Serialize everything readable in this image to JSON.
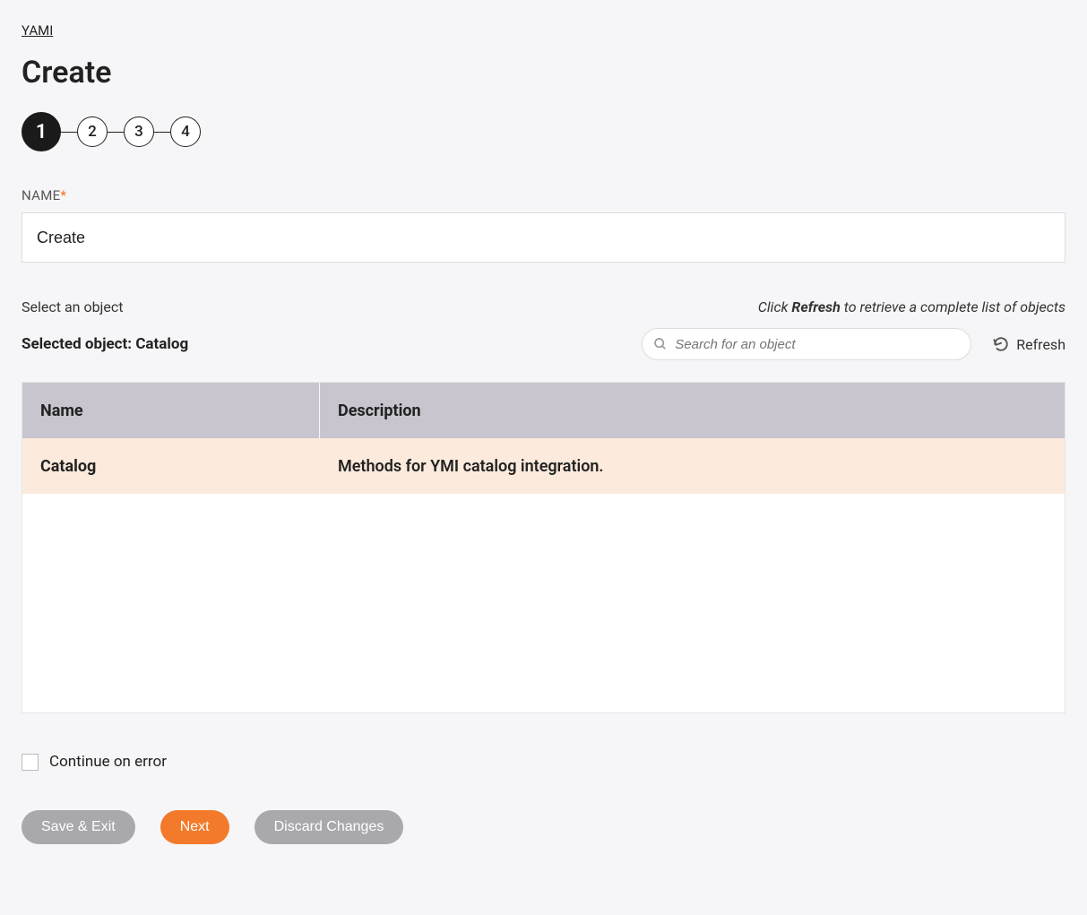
{
  "breadcrumb": "YAMI",
  "page_title": "Create",
  "stepper": {
    "active": "1",
    "steps": [
      "1",
      "2",
      "3",
      "4"
    ]
  },
  "name_field": {
    "label": "NAME",
    "value": "Create"
  },
  "select_object_label": "Select an object",
  "refresh_hint_prefix": "Click ",
  "refresh_hint_bold": "Refresh",
  "refresh_hint_suffix": " to retrieve a complete list of objects",
  "selected_object_label": "Selected object: ",
  "selected_object_value": "Catalog",
  "search": {
    "placeholder": "Search for an object"
  },
  "refresh_button": "Refresh",
  "table": {
    "headers": {
      "name": "Name",
      "description": "Description"
    },
    "rows": [
      {
        "name": "Catalog",
        "description": "Methods for YMI catalog integration."
      }
    ]
  },
  "continue_on_error_label": "Continue on error",
  "buttons": {
    "save_exit": "Save & Exit",
    "next": "Next",
    "discard": "Discard Changes"
  }
}
